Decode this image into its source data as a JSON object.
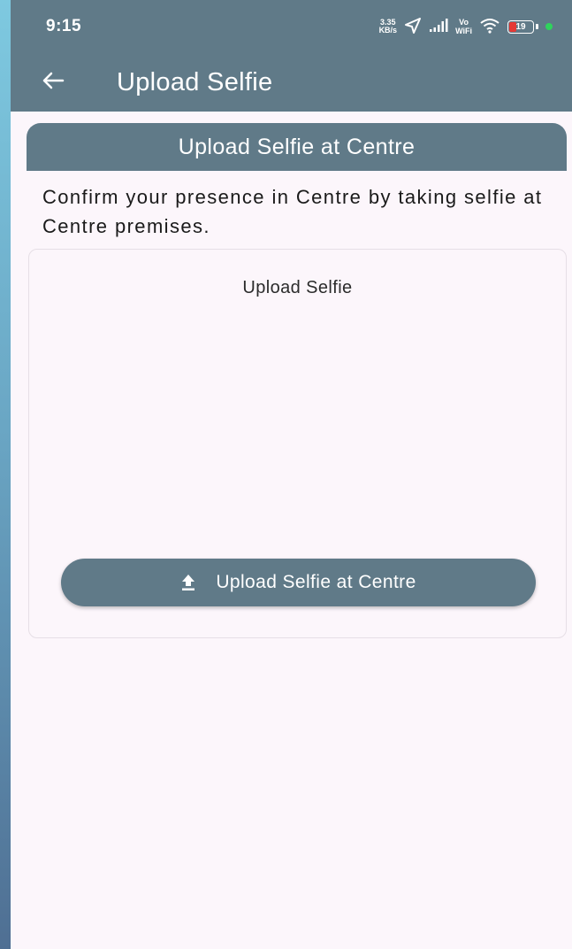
{
  "status_bar": {
    "time": "9:15",
    "net_speed_value": "3.35",
    "net_speed_unit": "KB/s",
    "vo_label": "Vo",
    "wifi_label": "WiFi",
    "battery_level": "19"
  },
  "app_bar": {
    "title": "Upload Selfie",
    "back_icon": "arrow-left-icon"
  },
  "section": {
    "header": "Upload Selfie at Centre",
    "instruction": "Confirm your presence in Centre by taking selfie at Centre premises."
  },
  "card": {
    "title": "Upload Selfie",
    "button_label": "Upload Selfie at Centre",
    "button_icon": "upload-icon"
  },
  "colors": {
    "primary": "#607a88",
    "background": "#fcf6fb",
    "battery_low": "#e53935",
    "indicator_dot": "#2fd35c"
  }
}
